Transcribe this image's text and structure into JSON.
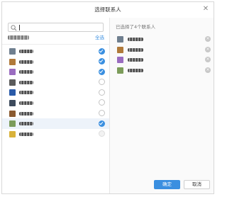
{
  "dialog": {
    "title": "选择联系人",
    "close_icon": "close-icon"
  },
  "search": {
    "value": "",
    "placeholder": ""
  },
  "left_panel": {
    "select_all_label": "全选",
    "contacts": [
      {
        "avatar_color": "#6f7f8f",
        "selected": true,
        "disabled": false
      },
      {
        "avatar_color": "#b07a3a",
        "selected": true,
        "disabled": false
      },
      {
        "avatar_color": "#9a6cc0",
        "selected": true,
        "disabled": false
      },
      {
        "avatar_color": "#5b5b5b",
        "selected": false,
        "disabled": false
      },
      {
        "avatar_color": "#2a5aa8",
        "selected": false,
        "disabled": false
      },
      {
        "avatar_color": "#3d4a5c",
        "selected": false,
        "disabled": false
      },
      {
        "avatar_color": "#8a5a30",
        "selected": false,
        "disabled": false
      },
      {
        "avatar_color": "#7c9c5a",
        "selected": true,
        "disabled": false,
        "highlight": true
      },
      {
        "avatar_color": "#d9b23a",
        "selected": false,
        "disabled": true
      }
    ]
  },
  "right_panel": {
    "title": "已选择了4个联系人",
    "selected": [
      {
        "avatar_color": "#6f7f8f"
      },
      {
        "avatar_color": "#b07a3a"
      },
      {
        "avatar_color": "#9a6cc0"
      },
      {
        "avatar_color": "#7c9c5a"
      }
    ]
  },
  "footer": {
    "ok_label": "确定",
    "cancel_label": "取消"
  },
  "colors": {
    "accent": "#3a8fe0"
  }
}
